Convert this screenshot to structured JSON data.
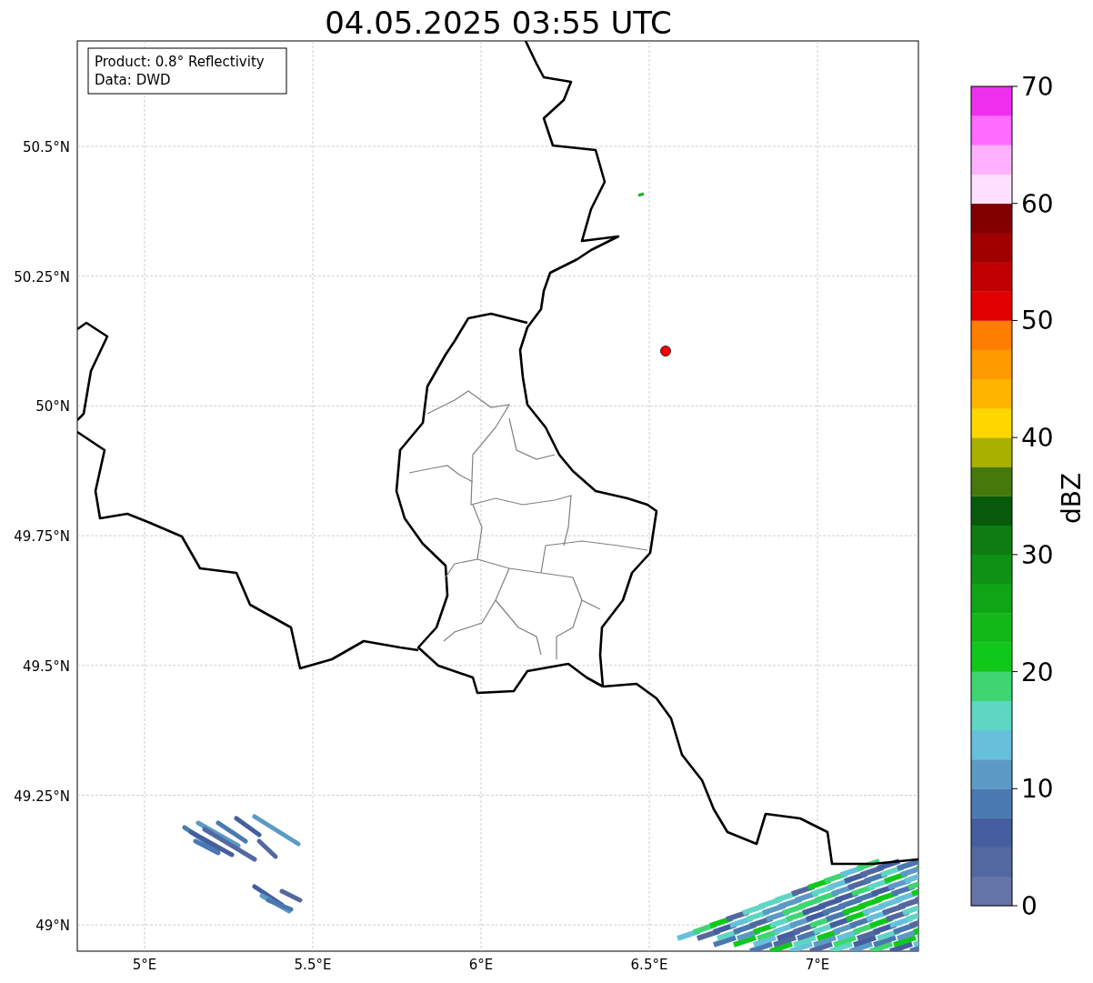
{
  "title": "04.05.2025 03:55 UTC",
  "info_box": [
    "Product: 0.8° Reflectivity",
    "Data: DWD"
  ],
  "lat_ticks": [
    "50.5°N",
    "50.25°N",
    "50°N",
    "49.75°N",
    "49.5°N",
    "49.25°N",
    "49°N"
  ],
  "lon_ticks": [
    "5°E",
    "5.5°E",
    "6°E",
    "6.5°E",
    "7°E"
  ],
  "colorbar": {
    "label": "dBZ",
    "ticks": [
      "70",
      "60",
      "50",
      "40",
      "30",
      "20",
      "10",
      "0"
    ],
    "segments": [
      {
        "color": "#6675a8"
      },
      {
        "color": "#5468a0"
      },
      {
        "color": "#445ea0"
      },
      {
        "color": "#4a78b0"
      },
      {
        "color": "#5b9ac5"
      },
      {
        "color": "#66c0dc"
      },
      {
        "color": "#5fd6c3"
      },
      {
        "color": "#3dd672"
      },
      {
        "color": "#10c81a"
      },
      {
        "color": "#12b818"
      },
      {
        "color": "#10a515"
      },
      {
        "color": "#0e9215"
      },
      {
        "color": "#0d7d12"
      },
      {
        "color": "#075a0a"
      },
      {
        "color": "#457a0a"
      },
      {
        "color": "#aab000"
      },
      {
        "color": "#ffd700"
      },
      {
        "color": "#ffb400"
      },
      {
        "color": "#ff9a00"
      },
      {
        "color": "#ff7d00"
      },
      {
        "color": "#e00000"
      },
      {
        "color": "#c00000"
      },
      {
        "color": "#a00000"
      },
      {
        "color": "#800000"
      },
      {
        "color": "#ffe0ff"
      },
      {
        "color": "#ffb0ff"
      },
      {
        "color": "#ff6aff"
      },
      {
        "color": "#ee30ee"
      }
    ]
  }
}
